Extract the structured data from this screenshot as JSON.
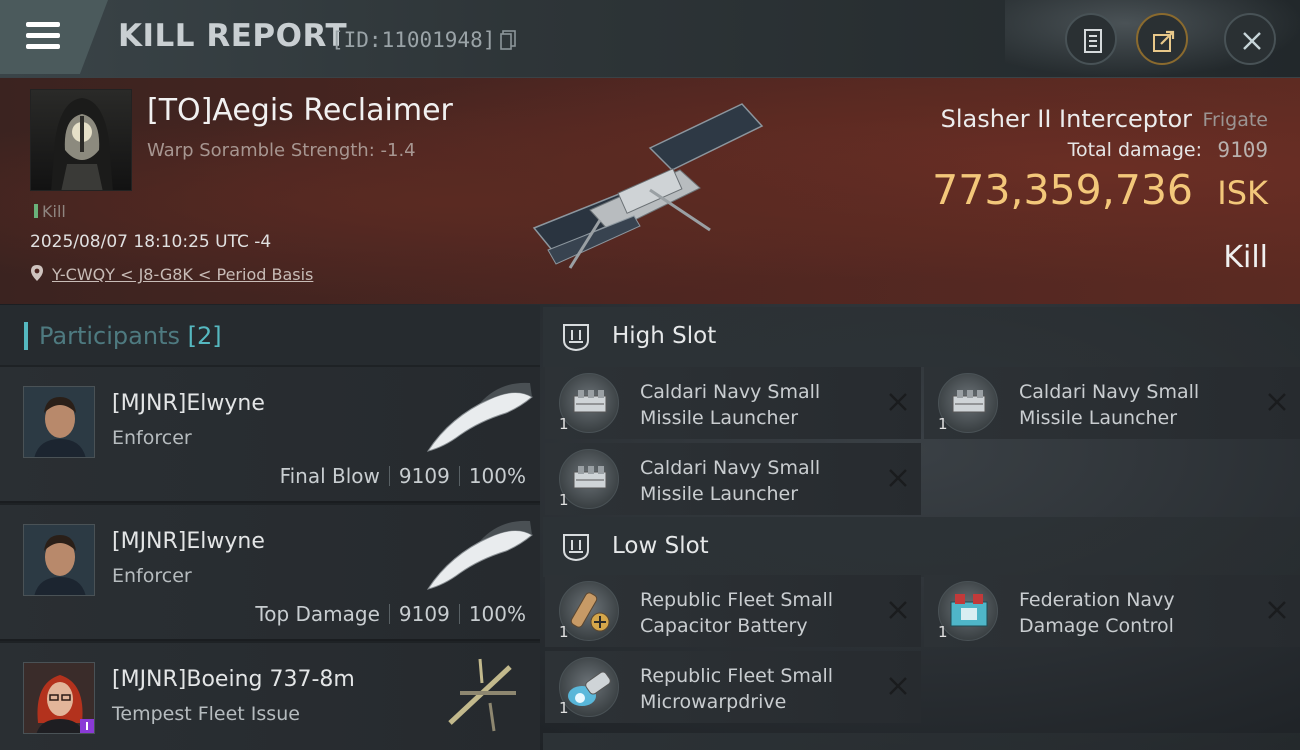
{
  "header": {
    "title": "KILL REPORT",
    "report_id": "[ID:11001948]"
  },
  "victim": {
    "name": "[TO]Aegis Reclaimer",
    "warp_scramble": "Warp Soramble Strength: -1.4",
    "kill_tag": "Kill",
    "datetime": "2025/08/07 18:10:25 UTC -4",
    "location": "Y-CWQY < J8-G8K < Period Basis",
    "ship_name": "Slasher II Interceptor",
    "ship_class": "Frigate",
    "total_damage_label": "Total damage:",
    "total_damage": "9109",
    "isk_value": "773,359,736",
    "isk_unit": "ISK",
    "result": "Kill"
  },
  "participants": {
    "label": "Participants",
    "count": "[2]",
    "rows": [
      {
        "name": "[MJNR]Elwyne",
        "ship": "Enforcer",
        "role": "Final Blow",
        "damage": "9109",
        "percent": "100%"
      },
      {
        "name": "[MJNR]Elwyne",
        "ship": "Enforcer",
        "role": "Top Damage",
        "damage": "9109",
        "percent": "100%"
      },
      {
        "name": "[MJNR]Boeing 737-8m",
        "ship": "Tempest Fleet Issue"
      }
    ]
  },
  "slots": {
    "high": {
      "label": "High Slot",
      "modules": [
        {
          "name": "Caldari Navy Small Missile Launcher",
          "qty": "1"
        },
        {
          "name": "Caldari Navy Small Missile Launcher",
          "qty": "1"
        },
        {
          "name": "Caldari Navy Small Missile Launcher",
          "qty": "1"
        }
      ]
    },
    "low": {
      "label": "Low Slot",
      "modules": [
        {
          "name": "Republic Fleet Small Capacitor Battery",
          "qty": "1"
        },
        {
          "name": "Federation Navy Damage Control",
          "qty": "1"
        },
        {
          "name": "Republic Fleet Small Microwarpdrive",
          "qty": "1"
        }
      ]
    }
  },
  "colors": {
    "accent": "#55b8c0",
    "isk": "#f3c77a",
    "hero_bg": "#4e2621"
  }
}
